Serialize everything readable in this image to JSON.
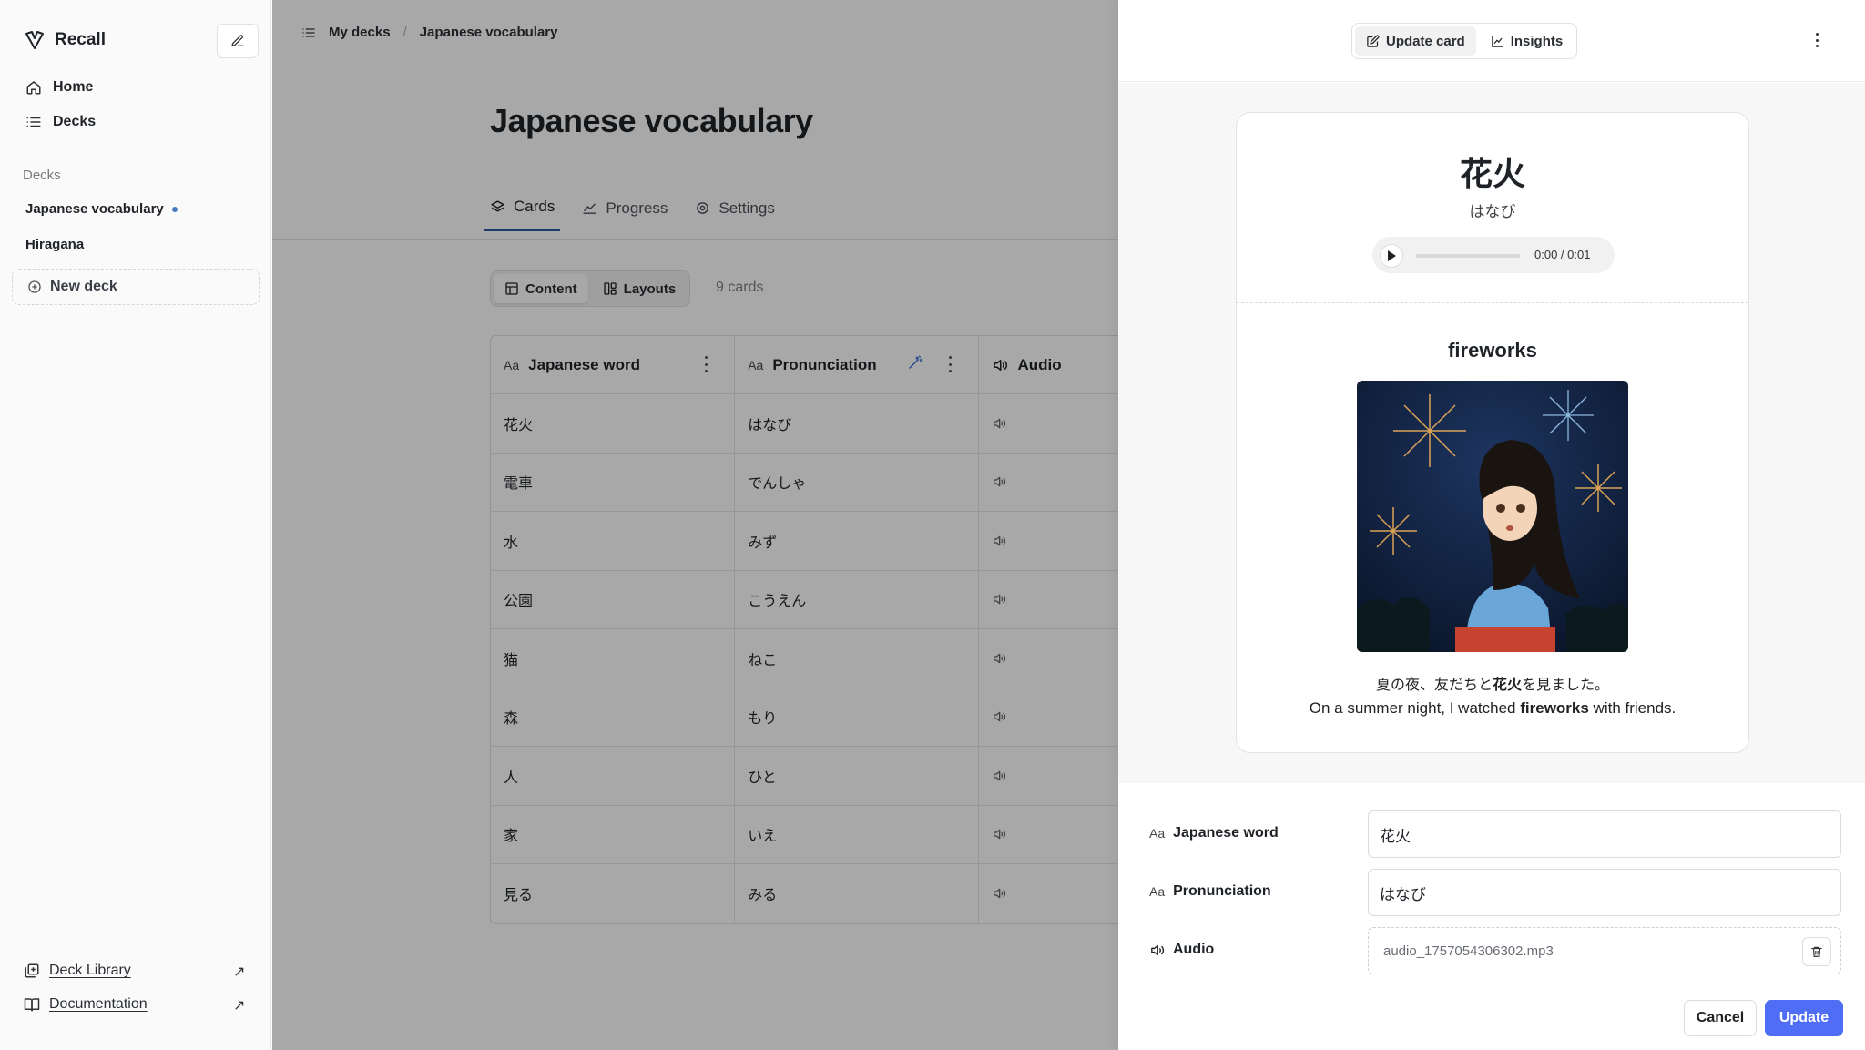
{
  "app": {
    "name": "Recall"
  },
  "sidebar": {
    "nav": [
      {
        "label": "Home",
        "icon": "home-icon"
      },
      {
        "label": "Decks",
        "icon": "list-icon"
      }
    ],
    "decks_label": "Decks",
    "decks": [
      {
        "label": "Japanese vocabulary",
        "active": true
      },
      {
        "label": "Hiragana",
        "active": false
      }
    ],
    "new_deck_label": "New deck",
    "links": [
      {
        "label": "Deck Library",
        "icon": "library-icon"
      },
      {
        "label": "Documentation",
        "icon": "book-icon"
      }
    ]
  },
  "breadcrumb": {
    "root": "My decks",
    "current": "Japanese vocabulary"
  },
  "page": {
    "title": "Japanese vocabulary",
    "tabs": [
      {
        "label": "Cards",
        "active": true
      },
      {
        "label": "Progress"
      },
      {
        "label": "Settings"
      }
    ],
    "view_toggle": {
      "content": "Content",
      "layouts": "Layouts",
      "active": "content"
    },
    "card_count": "9 cards"
  },
  "table": {
    "columns": [
      {
        "label": "Japanese word",
        "icon": "Aa"
      },
      {
        "label": "Pronunciation",
        "icon": "Aa"
      },
      {
        "label": "Audio",
        "icon": "speaker-icon"
      }
    ],
    "rows": [
      {
        "word": "花火",
        "reading": "はなび"
      },
      {
        "word": "電車",
        "reading": "でんしゃ"
      },
      {
        "word": "水",
        "reading": "みず"
      },
      {
        "word": "公園",
        "reading": "こうえん"
      },
      {
        "word": "猫",
        "reading": "ねこ"
      },
      {
        "word": "森",
        "reading": "もり"
      },
      {
        "word": "人",
        "reading": "ひと"
      },
      {
        "word": "家",
        "reading": "いえ"
      },
      {
        "word": "見る",
        "reading": "みる"
      }
    ]
  },
  "drawer": {
    "tabs": {
      "update": "Update card",
      "insights": "Insights",
      "active": "update"
    },
    "card": {
      "word": "花火",
      "reading": "はなび",
      "audio_time": "0:00 / 0:01",
      "meaning": "fireworks",
      "sentence_jp_before": "夏の夜、友だちと",
      "sentence_jp_bold": "花火",
      "sentence_jp_after": "を見ました。",
      "sentence_en_before": "On a summer night, I watched ",
      "sentence_en_bold": "fireworks",
      "sentence_en_after": " with friends."
    },
    "form": {
      "word_label": "Japanese word",
      "word_value": "花火",
      "reading_label": "Pronunciation",
      "reading_value": "はなび",
      "audio_label": "Audio",
      "audio_file": "audio_1757054306302.mp3"
    },
    "cancel_label": "Cancel",
    "update_label": "Update"
  },
  "colors": {
    "accent": "#4f6df5",
    "tab_underline": "#2a5aa0",
    "overlay": "rgba(0,0,0,0.34)"
  }
}
